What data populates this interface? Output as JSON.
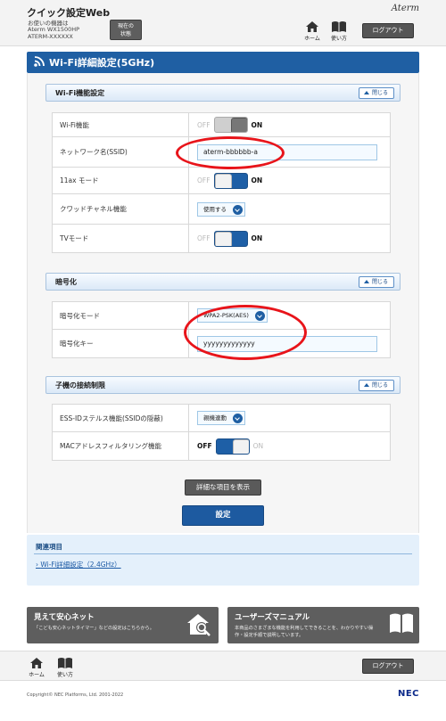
{
  "header": {
    "app_title": "クイック設定Web",
    "device_line1": "お使いの機器は",
    "device_line2": "Aterm WX1500HP",
    "device_line3": "ATERM-XXXXXX",
    "status_button": "現在の\n状態",
    "brand": "Aterm",
    "home_label": "ホーム",
    "help_label": "使い方",
    "logout_label": "ログアウト"
  },
  "page": {
    "title": "Wi-Fi詳細設定(5GHz)"
  },
  "sections": {
    "wifi_function": {
      "title": "Wi-Fi機能設定",
      "collapse_label": "閉じる",
      "rows": {
        "wifi": {
          "label": "Wi-Fi機能",
          "off": "OFF",
          "on": "ON",
          "state": "on"
        },
        "ssid": {
          "label": "ネットワーク名(SSID)",
          "value": "aterm-bbbbbb-a"
        },
        "ax": {
          "label": "11ax モード",
          "off": "OFF",
          "on": "ON",
          "state": "on"
        },
        "quad": {
          "label": "クワッドチャネル機能",
          "value": "使用する"
        },
        "tv": {
          "label": "TVモード",
          "off": "OFF",
          "on": "ON",
          "state": "on"
        }
      }
    },
    "encryption": {
      "title": "暗号化",
      "collapse_label": "閉じる",
      "rows": {
        "mode": {
          "label": "暗号化モード",
          "value": "WPA2-PSK(AES)"
        },
        "key": {
          "label": "暗号化キー",
          "value": "yyyyyyyyyyyyy"
        }
      }
    },
    "client": {
      "title": "子機の接続制限",
      "collapse_label": "閉じる",
      "rows": {
        "stealth": {
          "label": "ESS-IDステルス機能(SSIDの隠蔽)",
          "value": "親機連動"
        },
        "mac": {
          "label": "MACアドレスフィルタリング機能",
          "off": "OFF",
          "on": "ON",
          "state": "off"
        }
      }
    }
  },
  "actions": {
    "detail_label": "詳細な項目を表示",
    "apply_label": "設定"
  },
  "related": {
    "title": "関連項目",
    "link": "Wi-Fi詳細設定（2.4GHz）"
  },
  "banners": {
    "safe_net": {
      "title": "見えて安心ネット",
      "desc": "「こども安心ネットタイマー」などの設定はこちらから。"
    },
    "manual": {
      "title": "ユーザーズマニュアル",
      "desc_line1": "本商品のさまざまな機能を利用してできることを、わかりやすい操",
      "desc_line2": "作・設定手順で説明しています。"
    }
  },
  "footer": {
    "home_label": "ホーム",
    "help_label": "使い方",
    "logout_label": "ログアウト",
    "copyright": "Copyright© NEC Platforms, Ltd. 2001-2022",
    "logo": "NEC"
  },
  "colors": {
    "primary_blue": "#1f5fa3",
    "annotation_red": "#e8141a",
    "dark_button": "#5a5a5a"
  }
}
